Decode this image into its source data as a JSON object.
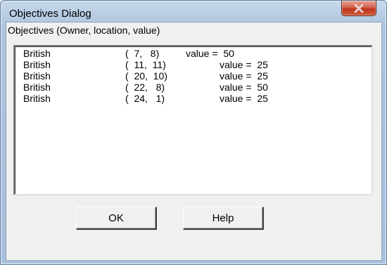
{
  "window": {
    "title": "Objectives Dialog",
    "close_icon": "close-x-icon"
  },
  "group": {
    "label": "Objectives (Owner, location, value)"
  },
  "objectives": [
    {
      "owner": "British",
      "location": "(  7,   8)",
      "value": "value =  50"
    },
    {
      "owner": "British",
      "location": "(  11,  11)",
      "value": "value =  25"
    },
    {
      "owner": "British",
      "location": "(  20,  10)",
      "value": "value =  25"
    },
    {
      "owner": "British",
      "location": "(  22,   8)",
      "value": "value =  50"
    },
    {
      "owner": "British",
      "location": "(  24,   1)",
      "value": "value =  25"
    }
  ],
  "buttons": {
    "ok": "OK",
    "help": "Help"
  },
  "colors": {
    "titlebar": "#b9cde4",
    "close_button": "#c0341f",
    "client_bg": "#f0f0f0",
    "list_bg": "#ffffff"
  }
}
